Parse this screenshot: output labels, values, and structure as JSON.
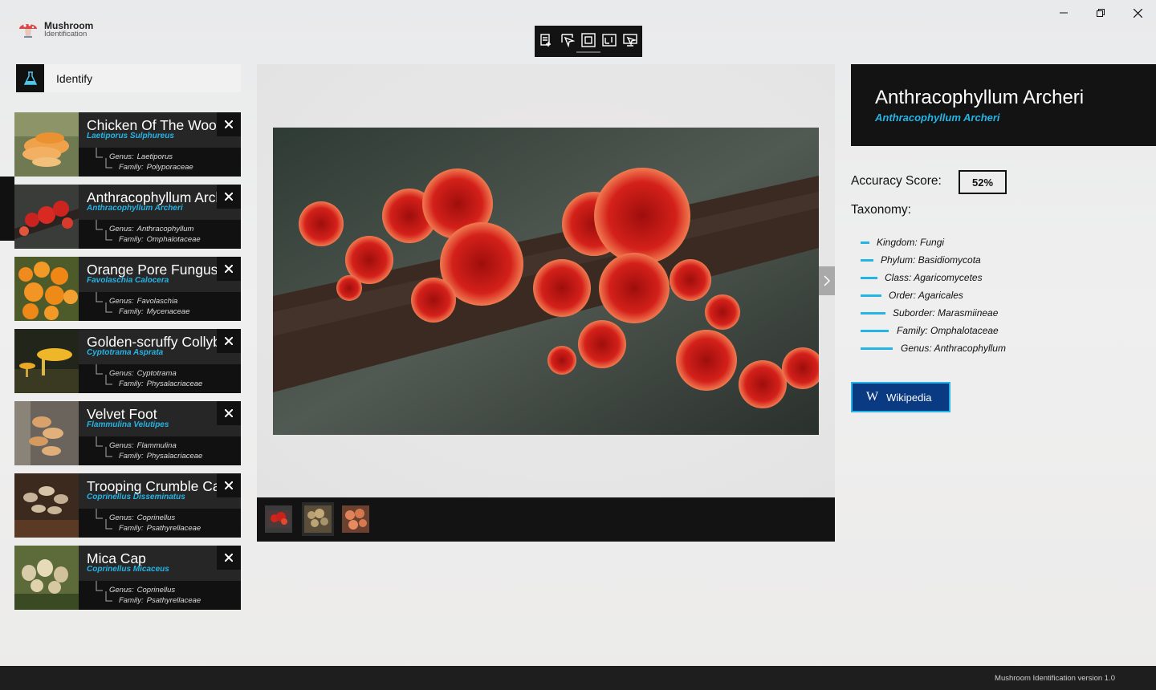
{
  "app": {
    "name_line1": "Mushroom",
    "name_line2": "Identification"
  },
  "sidebar": {
    "identify_label": "Identify",
    "cards": [
      {
        "name": "Chicken Of The Woods",
        "scientific": "Laetiporus Sulphureus",
        "genus": "Laetiporus",
        "family": "Polyporaceae"
      },
      {
        "name": "Anthracophyllum Archeri",
        "scientific": "Anthracophyllum Archeri",
        "genus": "Anthracophyllum",
        "family": "Omphalotaceae"
      },
      {
        "name": "Orange Pore Fungus",
        "scientific": "Favolaschia Calocera",
        "genus": "Favolaschia",
        "family": "Mycenaceae"
      },
      {
        "name": "Golden-scruffy Collybia",
        "scientific": "Cyptotrama Asprata",
        "genus": "Cyptotrama",
        "family": "Physalacriaceae"
      },
      {
        "name": "Velvet Foot",
        "scientific": "Flammulina Velutipes",
        "genus": "Flammulina",
        "family": "Physalacriaceae"
      },
      {
        "name": "Trooping Crumble Cap",
        "scientific": "Coprinellus Disseminatus",
        "genus": "Coprinellus",
        "family": "Psathyrellaceae"
      },
      {
        "name": "Mica Cap",
        "scientific": "Coprinellus Micaceus",
        "genus": "Coprinellus",
        "family": "Psathyrellaceae"
      }
    ],
    "genus_label": "Genus:",
    "family_label": "Family:"
  },
  "detail": {
    "title": "Anthracophyllum Archeri",
    "scientific": "Anthracophyllum Archeri",
    "accuracy_label": "Accuracy Score:",
    "accuracy_value": "52%",
    "taxonomy_label": "Taxonomy:",
    "taxonomy": [
      "Kingdom: Fungi",
      "Phylum: Basidiomycota",
      "Class: Agaricomycetes",
      "Order: Agaricales",
      "Suborder: Marasmiineae",
      "Family: Omphalotaceae",
      "Genus: Anthracophyllum"
    ],
    "wiki_glyph": "W",
    "wiki_label": "Wikipedia"
  },
  "footer": {
    "version": "Mushroom Identification version 1.0"
  },
  "colors": {
    "accent": "#26b4e6",
    "wiki": "#0a3a82",
    "dark": "#131313"
  },
  "icons": [
    "mushroom-logo-icon",
    "flask-icon",
    "close-icon",
    "chevron-right-icon",
    "minimize-icon",
    "restore-icon",
    "window-close-icon"
  ]
}
